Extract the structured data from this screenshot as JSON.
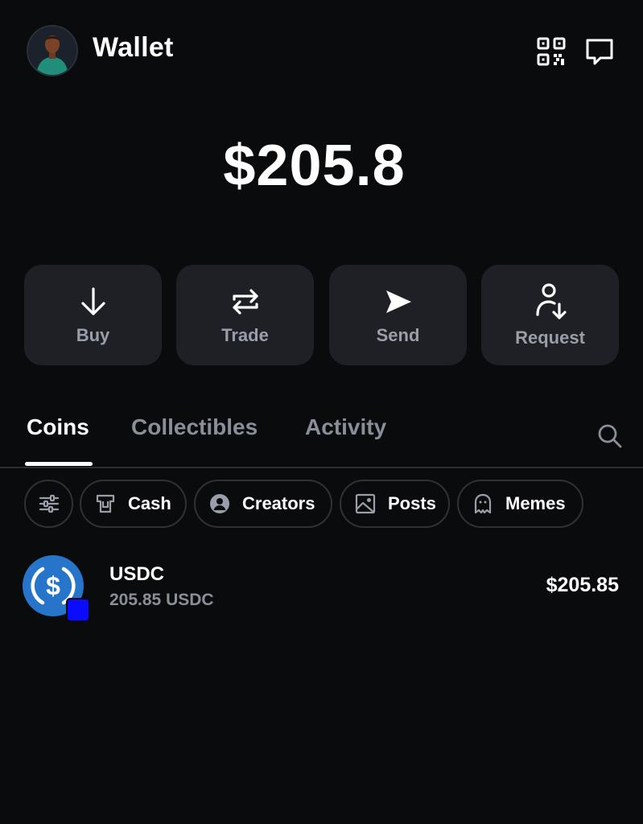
{
  "header": {
    "title": "Wallet",
    "avatar_icon": "user-avatar",
    "qr_icon": "qr-code-icon",
    "chat_icon": "chat-bubble-icon"
  },
  "balance": {
    "total": "$205.8"
  },
  "actions": [
    {
      "label": "Buy",
      "icon": "arrow-down-icon"
    },
    {
      "label": "Trade",
      "icon": "swap-arrows-icon"
    },
    {
      "label": "Send",
      "icon": "paper-plane-icon"
    },
    {
      "label": "Request",
      "icon": "person-arrow-down-icon"
    }
  ],
  "tabs": [
    {
      "label": "Coins",
      "active": true
    },
    {
      "label": "Collectibles",
      "active": false
    },
    {
      "label": "Activity",
      "active": false
    }
  ],
  "filters": [
    {
      "label": "",
      "icon": "sliders-icon"
    },
    {
      "label": "Cash",
      "icon": "cash-icon"
    },
    {
      "label": "Creators",
      "icon": "person-circle-icon"
    },
    {
      "label": "Posts",
      "icon": "image-icon"
    },
    {
      "label": "Memes",
      "icon": "ghost-icon"
    }
  ],
  "coins": [
    {
      "name": "USDC",
      "amount": "205.85 USDC",
      "value": "$205.85",
      "icon": "usdc-logo-icon"
    }
  ],
  "colors": {
    "background": "#0a0b0d",
    "card": "#1e2025",
    "muted_text": "#8a8e98",
    "usdc_blue": "#2775ca",
    "badge_blue": "#0a0bff"
  }
}
